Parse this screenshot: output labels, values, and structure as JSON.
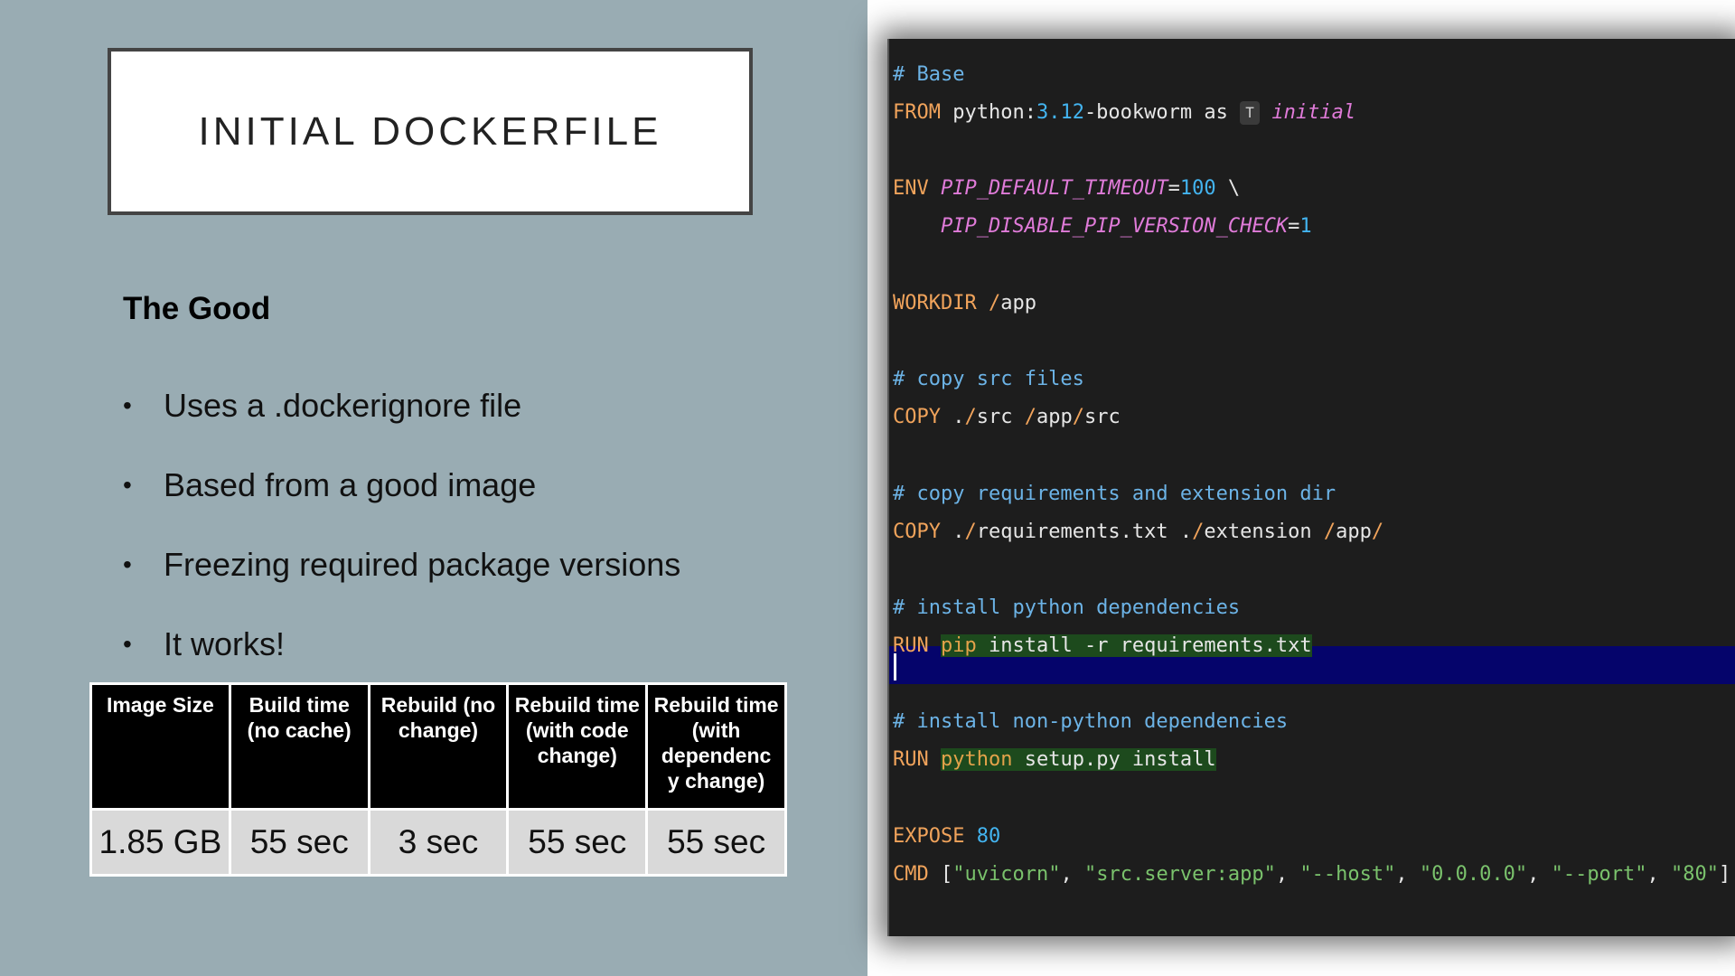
{
  "slide": {
    "title": "INITIAL DOCKERFILE",
    "subheading": "The Good",
    "bullets": [
      "Uses a .dockerignore file",
      "Based from a good image",
      "Freezing required package versions",
      "It works!"
    ],
    "bullet_glyph": "•"
  },
  "table": {
    "headers": [
      "Image Size",
      "Build time (no cache)",
      "Rebuild (no change)",
      "Rebuild time (with code change)",
      "Rebuild time (with dependenc y change)"
    ],
    "row": [
      "1.85 GB",
      "55 sec",
      "3 sec",
      "55 sec",
      "55 sec"
    ]
  },
  "code": {
    "icon": "tag-icon",
    "tokens": {
      "l1": "# Base",
      "l2_kw": "FROM",
      "l2_a": " python:",
      "l2_num": "3.12",
      "l2_b": "-bookworm as ",
      "l2_icon": "T",
      "l2_tag": "initial",
      "l3_kw": "ENV",
      "l3_var": "PIP_DEFAULT_TIMEOUT",
      "l3_eq": "=",
      "l3_num": "100",
      "l3_end": " \\",
      "l4_var": "PIP_DISABLE_PIP_VERSION_CHECK",
      "l4_eq": "=",
      "l4_num": "1",
      "l5_kw": "WORKDIR",
      "l5_slash": " /",
      "l5_txt": "app",
      "l6": "# copy src files",
      "l7_kw": "COPY",
      "l7_a": " .",
      "l7_s1": "/",
      "l7_b": "src ",
      "l7_s2": "/",
      "l7_c": "app",
      "l7_s3": "/",
      "l7_d": "src",
      "l8": "# copy requirements and extension dir",
      "l9_kw": "COPY",
      "l9_a": " .",
      "l9_s1": "/",
      "l9_b": "requirements.txt .",
      "l9_s2": "/",
      "l9_c": "extension ",
      "l9_s3": "/",
      "l9_d": "app",
      "l9_s4": "/",
      "l10": "# install python dependencies",
      "l11_kw": "RUN",
      "l11_cmd": "pip",
      "l11_rest": " install -r requirements.txt",
      "l12": "# install non-python dependencies",
      "l13_kw": "RUN",
      "l13_cmd": "python",
      "l13_rest": " setup.py install",
      "l14_kw": "EXPOSE",
      "l14_num": "80",
      "l15_kw": "CMD",
      "l15_open": " [",
      "l15_s1": "\"uvicorn\"",
      "l15_c1": ", ",
      "l15_s2": "\"src.server:app\"",
      "l15_c2": ", ",
      "l15_s3": "\"--host\"",
      "l15_c3": ", ",
      "l15_s4": "\"0.0.0.0\"",
      "l15_c4": ", ",
      "l15_s5": "\"--port\"",
      "l15_c5": ", ",
      "l15_s6": "\"80\"",
      "l15_close": "]"
    }
  },
  "colors": {
    "slide_bg": "#99acb3",
    "code_bg": "#1d1d1d",
    "selected_line": "#05046b",
    "keyword": "#f0a35b",
    "comment": "#6cb3e6",
    "number": "#43b4f0",
    "variable": "#e07bd9",
    "string": "#7ac26c"
  }
}
